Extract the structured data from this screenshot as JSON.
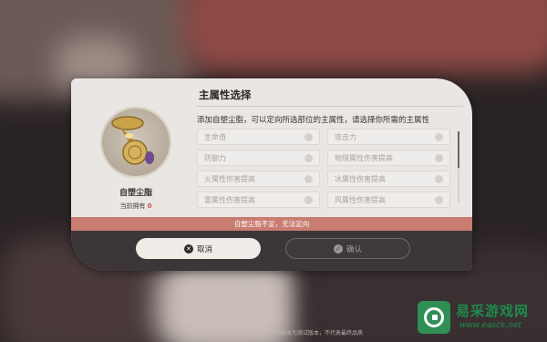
{
  "dialog": {
    "title": "主属性选择",
    "description": "添加自塑尘脂，可以定向所选部位的主属性，请选择你所需的主属性",
    "item": {
      "name": "自塑尘脂",
      "owned_label": "当前拥有",
      "owned_count": "0"
    },
    "options": [
      {
        "label": "生命值"
      },
      {
        "label": "攻击力"
      },
      {
        "label": "防御力"
      },
      {
        "label": "物理属性伤害提高"
      },
      {
        "label": "火属性伤害提高"
      },
      {
        "label": "冰属性伤害提高"
      },
      {
        "label": "雷属性伤害提高"
      },
      {
        "label": "风属性伤害提高"
      }
    ],
    "warning": "自塑尘脂不足，无法定向",
    "cancel_label": "取消",
    "confirm_label": "确认"
  },
  "footer_note": "当前版本为测试版本，不代表最终品质",
  "watermark": {
    "cn": "易采游戏网",
    "url": "www.easck.net"
  },
  "colors": {
    "dialog_bg": "#e9e6e3",
    "warning_bar": "#c97c70",
    "owned_count": "#c8524b",
    "watermark": "#1e8a4a"
  },
  "icons": [
    "close-icon",
    "check-icon",
    "item-dust-icon",
    "radio-icon",
    "watermark-logo-icon"
  ]
}
